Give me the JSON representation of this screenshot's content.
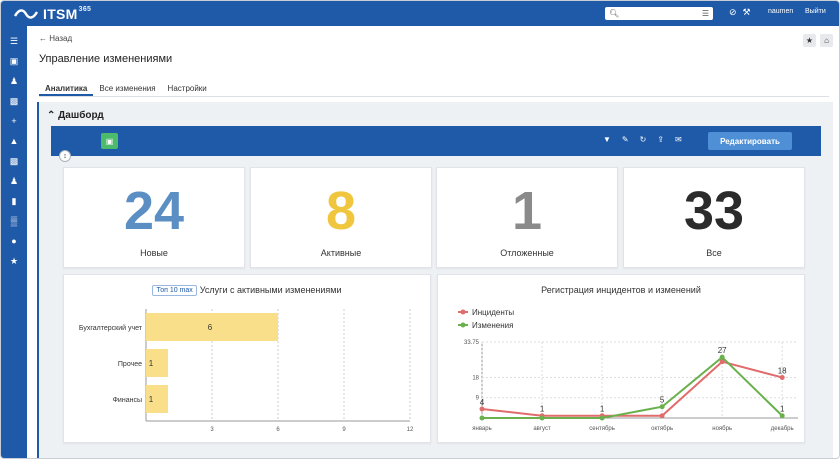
{
  "app": {
    "logo_text": "ITSM",
    "logo_sup": "365",
    "user": "naumen",
    "logout": "Выйти",
    "search_placeholder": ""
  },
  "page": {
    "back_label": "← Назад",
    "title": "Управление изменениями",
    "tabs": [
      {
        "label": "Аналитика",
        "active": true
      },
      {
        "label": "Все изменения",
        "active": false
      },
      {
        "label": "Настройки",
        "active": false
      }
    ]
  },
  "dashboard": {
    "title": "Дашборд",
    "edit_label": "Редактировать",
    "kpis": [
      {
        "value": "24",
        "label": "Новые",
        "color": "#5b8fc4"
      },
      {
        "value": "8",
        "label": "Активные",
        "color": "#f0c63e"
      },
      {
        "value": "1",
        "label": "Отложенные",
        "color": "#8a8a8a"
      },
      {
        "value": "33",
        "label": "Все",
        "color": "#2b2b2b"
      }
    ]
  },
  "chart_data": [
    {
      "type": "bar",
      "orientation": "horizontal",
      "badge": "Топ 10 max",
      "title": "Услуги с активными изменениями",
      "categories": [
        "Бухгалтерский учет",
        "Прочее",
        "Финансы"
      ],
      "values": [
        6,
        1,
        1
      ],
      "xticks": [
        "3",
        "6",
        "9",
        "12"
      ],
      "xlim": [
        0,
        12
      ],
      "color": "#f9df8a"
    },
    {
      "type": "line",
      "title": "Регистрация инцидентов и изменений",
      "categories": [
        "январь",
        "август",
        "сентябрь",
        "октябрь",
        "ноябрь",
        "декабрь"
      ],
      "yticks": [
        "9",
        "18",
        "33.75"
      ],
      "ylim": [
        0,
        33.75
      ],
      "series": [
        {
          "name": "Инциденты",
          "color": "#e06c6c",
          "values": [
            4,
            1,
            1,
            1,
            25,
            18
          ],
          "labels": [
            "4",
            "1",
            "1",
            "",
            "",
            "18"
          ]
        },
        {
          "name": "Изменения",
          "color": "#6ab04c",
          "values": [
            0,
            0,
            0,
            5,
            27,
            1
          ],
          "labels": [
            "",
            "",
            "",
            "5",
            "27",
            "1"
          ]
        }
      ]
    }
  ]
}
